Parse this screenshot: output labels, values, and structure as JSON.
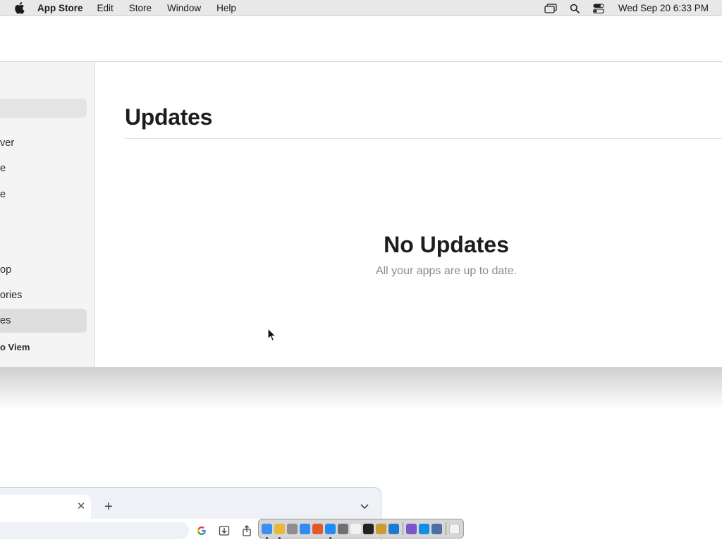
{
  "menubar": {
    "app_name": "App Store",
    "items": [
      "Edit",
      "Store",
      "Window",
      "Help"
    ],
    "clock": "Wed Sep 20  6:33 PM"
  },
  "sidebar": {
    "items": [
      {
        "label": "ver"
      },
      {
        "label": "e"
      },
      {
        "label": "e"
      },
      {
        "label": "op"
      },
      {
        "label": "ories"
      },
      {
        "label": "es",
        "active": true
      }
    ],
    "user_label": "o Viem"
  },
  "main": {
    "title": "Updates",
    "empty_title": "No Updates",
    "empty_subtitle": "All your apps are up to date."
  },
  "browser": {
    "tab_close": "✕",
    "new_tab": "+"
  },
  "dock": {
    "apps": [
      {
        "name": "finder",
        "color": "#3d8ef0",
        "running": true
      },
      {
        "name": "chrome",
        "color": "#e9b838",
        "running": true
      },
      {
        "name": "launchpad",
        "color": "#8d8d93",
        "running": false
      },
      {
        "name": "safari",
        "color": "#2f8cf1",
        "running": false
      },
      {
        "name": "firefox",
        "color": "#e2572b",
        "running": false
      },
      {
        "name": "app-store",
        "color": "#1f8bf5",
        "running": true
      },
      {
        "name": "settings",
        "color": "#6f6f75",
        "running": false
      },
      {
        "name": "pen",
        "color": "#f1f1f1",
        "running": false
      },
      {
        "name": "terminal",
        "color": "#222222",
        "running": false
      },
      {
        "name": "script",
        "color": "#ce9b2c",
        "running": false
      },
      {
        "name": "vscode",
        "color": "#1d7ad0",
        "running": false
      },
      {
        "name": "visual-studio",
        "color": "#7b56c9",
        "running": false
      },
      {
        "name": "docs",
        "color": "#0f8fe6",
        "running": false
      },
      {
        "name": "screen",
        "color": "#4f6fa4",
        "running": false
      }
    ]
  }
}
